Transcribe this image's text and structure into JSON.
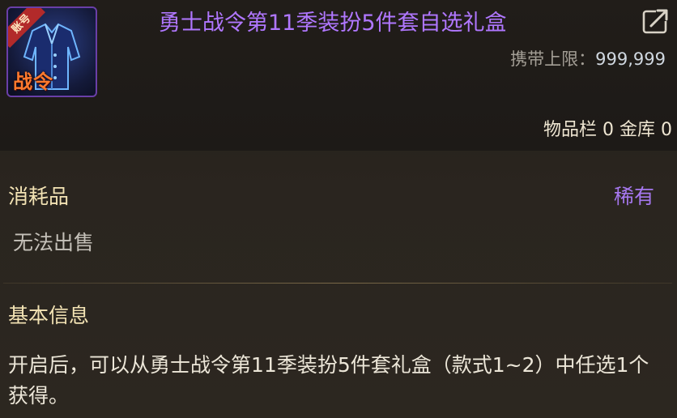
{
  "item": {
    "title": "勇士战令第11季装扮5件套自选礼盒",
    "icon_ribbon": "账号",
    "icon_badge": "战令",
    "icon_name": "battle-pass-outfit-icon",
    "carry_limit_label": "携带上限：",
    "carry_limit_value": "999,999",
    "inventory_label": "物品栏",
    "inventory_count": "0",
    "vault_label": "金库",
    "vault_count": "0",
    "category": "消耗品",
    "rarity": "稀有",
    "sell_status": "无法出售"
  },
  "basic_info": {
    "heading": "基本信息",
    "description": "开启后，可以从勇士战令第11季装扮5件套礼盒（款式1~2）中任选1个获得。"
  },
  "colors": {
    "title": "#b077ff",
    "rarity": "#a577ee",
    "heading": "#f3e3b4",
    "ribbon": "#b22a2a",
    "badge": "#ff7a2e"
  }
}
